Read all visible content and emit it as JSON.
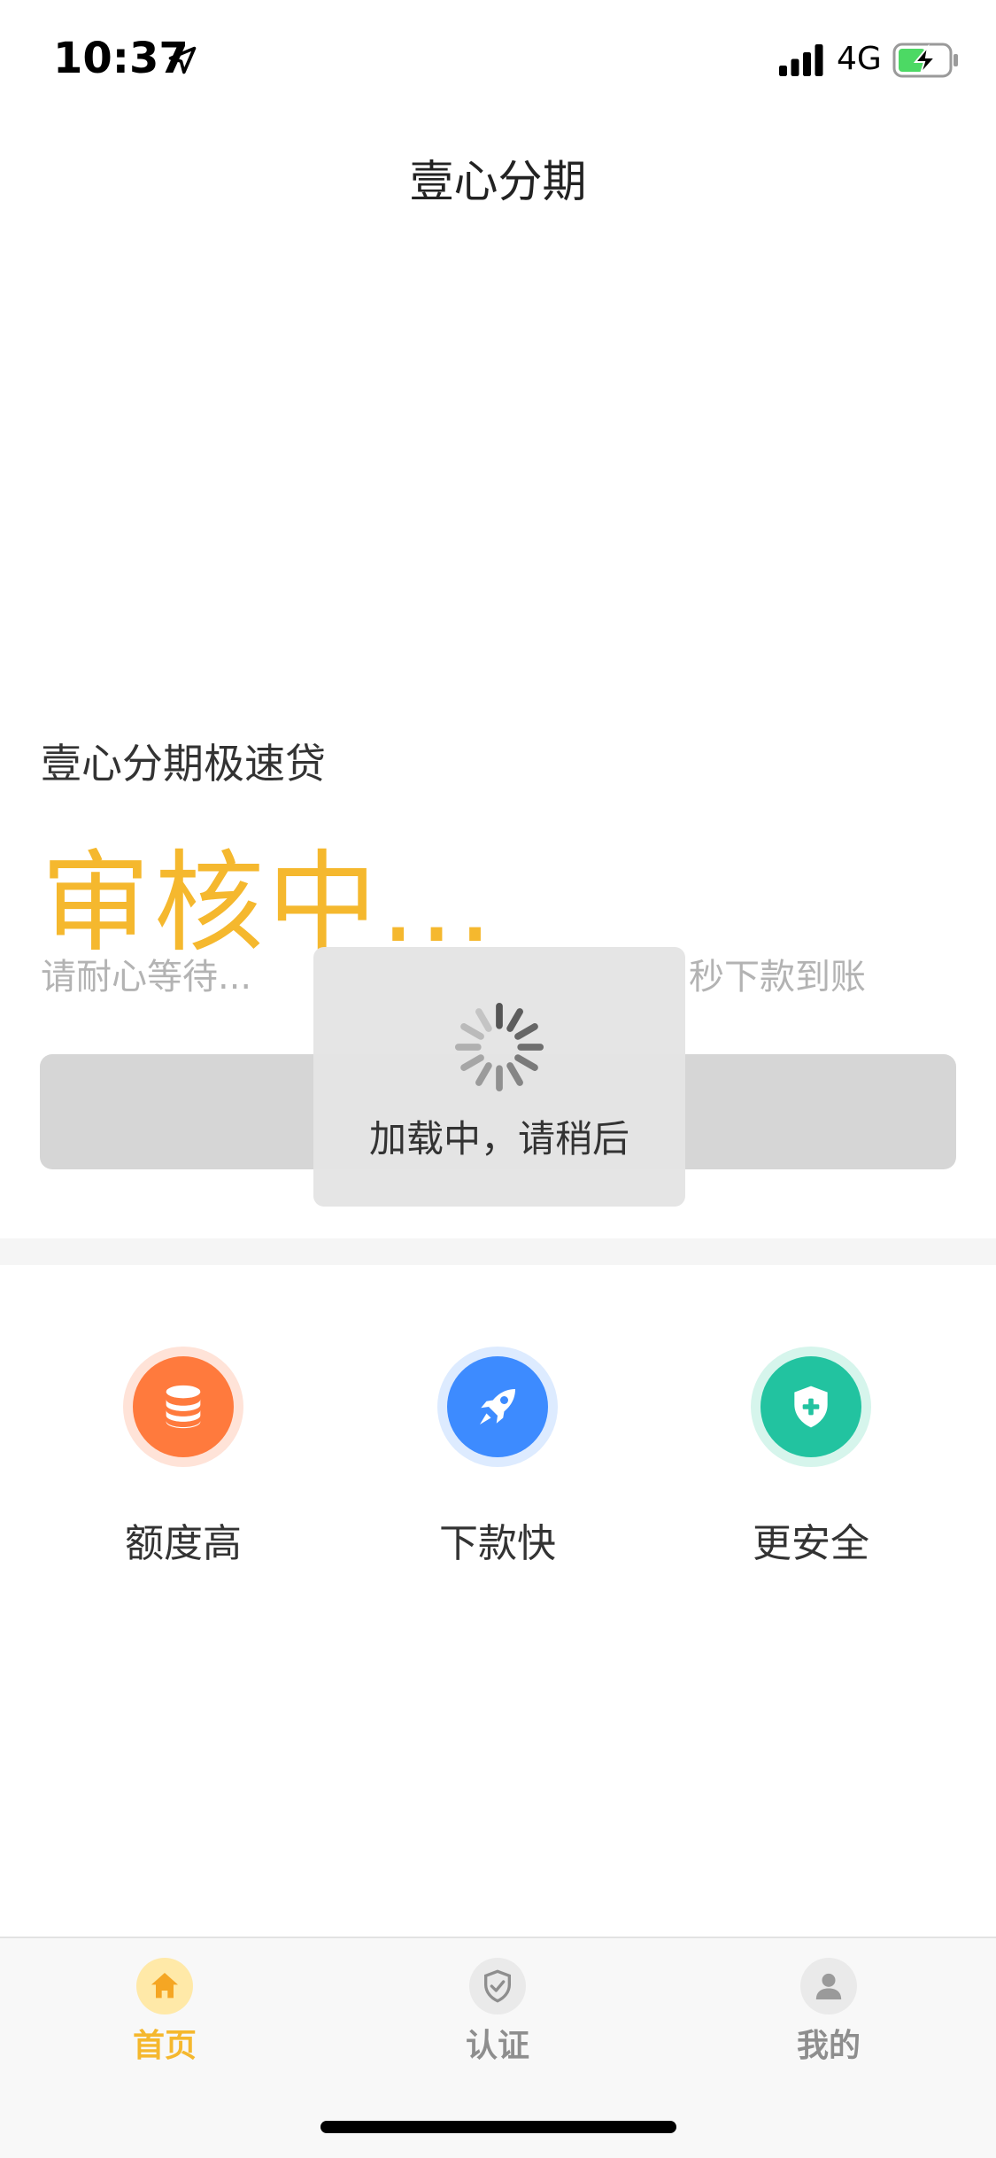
{
  "status_bar": {
    "time": "10:37",
    "network": "4G",
    "icons": [
      "location-arrow-icon",
      "signal-bars-icon",
      "battery-charging-icon"
    ]
  },
  "nav": {
    "title": "壹心分期"
  },
  "main": {
    "product_name": "壹心分期极速贷",
    "status_headline": "审核中...",
    "hint_left": "请耐心等待...",
    "hint_right": "秒下款到账"
  },
  "features": [
    {
      "label": "额度高",
      "icon": "database-icon",
      "color": "#FF7A3D"
    },
    {
      "label": "下款快",
      "icon": "rocket-icon",
      "color": "#3D8BFF"
    },
    {
      "label": "更安全",
      "icon": "shield-plus-icon",
      "color": "#22C3A0"
    }
  ],
  "loading": {
    "text": "加载中，请稍后",
    "icon": "spinner-icon"
  },
  "tab_bar": {
    "tabs": [
      {
        "label": "首页",
        "icon": "home-icon",
        "active": true
      },
      {
        "label": "认证",
        "icon": "shield-check-icon",
        "active": false
      },
      {
        "label": "我的",
        "icon": "user-icon",
        "active": false
      }
    ],
    "active_color": "#F5B82E",
    "inactive_color": "#8E8E8E"
  },
  "colors": {
    "accent": "#F5B82E",
    "button_disabled": "#D6D6D6"
  }
}
